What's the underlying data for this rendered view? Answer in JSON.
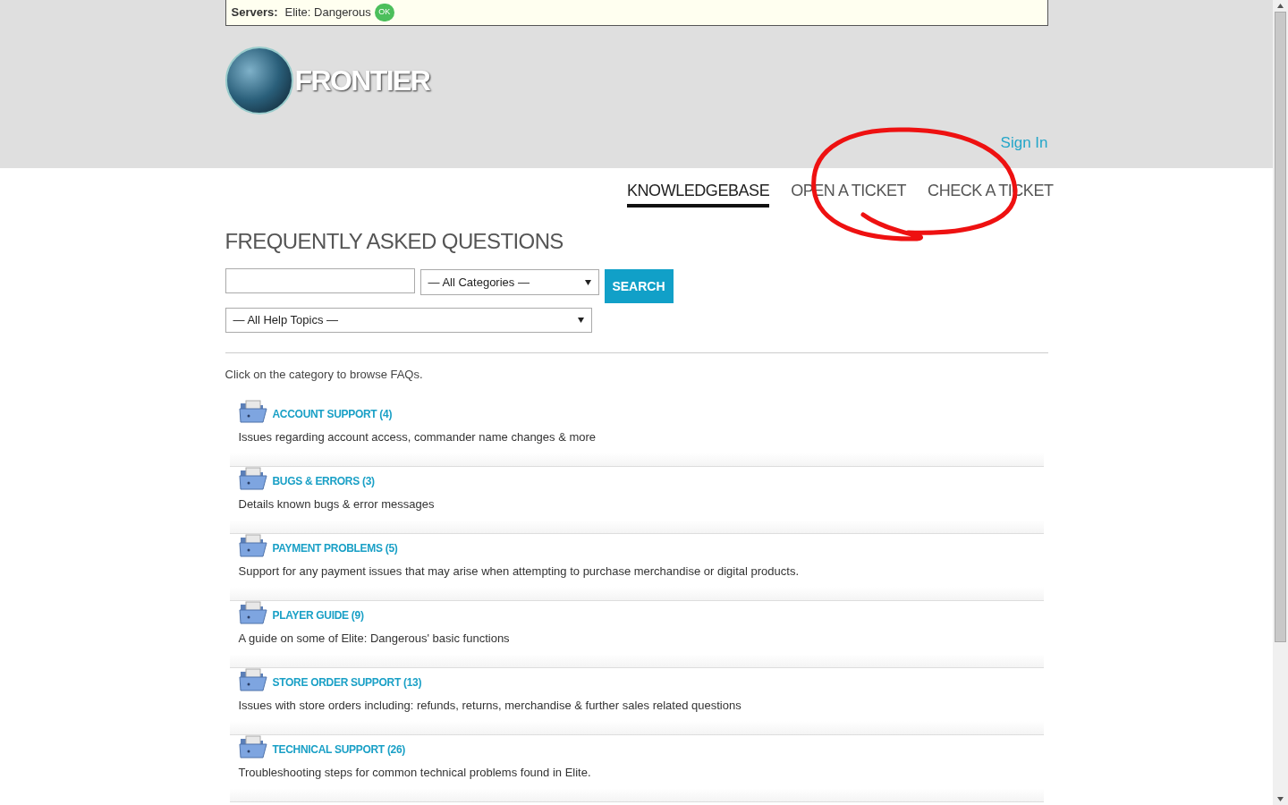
{
  "server_bar": {
    "label": "Servers:",
    "server": "Elite: Dangerous",
    "status": "OK"
  },
  "logo": {
    "text": "FRONTIER"
  },
  "sign_in": "Sign In",
  "nav": [
    {
      "label": "KNOWLEDGEBASE",
      "selected": true
    },
    {
      "label": "OPEN A TICKET",
      "selected": false
    },
    {
      "label": "CHECK A TICKET",
      "selected": false
    }
  ],
  "heading": "FREQUENTLY ASKED QUESTIONS",
  "search": {
    "category": "— All Categories —",
    "button": "SEARCH",
    "topic": "— All Help Topics —"
  },
  "intro": "Click on the category to browse FAQs.",
  "categories": [
    {
      "title": "ACCOUNT SUPPORT (4)",
      "description": "Issues regarding account access, commander name changes & more"
    },
    {
      "title": "BUGS & ERRORS (3)",
      "description": "Details known bugs & error messages"
    },
    {
      "title": "PAYMENT PROBLEMS (5)",
      "description": "Support for any payment issues that may arise when attempting to purchase merchandise or digital products."
    },
    {
      "title": "PLAYER GUIDE (9)",
      "description": "A guide on some of Elite: Dangerous' basic functions"
    },
    {
      "title": "STORE ORDER SUPPORT (13)",
      "description": "Issues with store orders including: refunds, returns, merchandise & further sales related questions"
    },
    {
      "title": "TECHNICAL SUPPORT (26)",
      "description": "Troubleshooting steps for common technical problems found in Elite."
    }
  ]
}
